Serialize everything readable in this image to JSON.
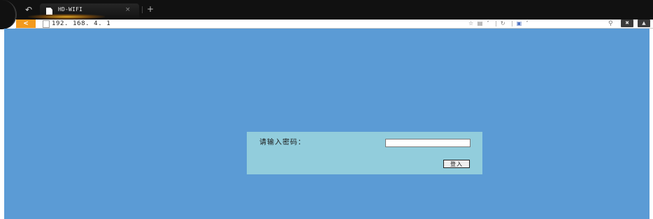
{
  "browser": {
    "tab": {
      "title": "HD-WIFI",
      "close_glyph": "×"
    },
    "new_tab_glyph": "+",
    "address_bar": {
      "url": "192. 168. 4. 1"
    },
    "icons": {
      "back": "back-arrow-icon",
      "page": "page-icon",
      "favorites": "star-icon",
      "reader": "reader-icon",
      "refresh": "refresh-icon",
      "extension": "extension-icon",
      "search": "search-icon"
    },
    "colors": {
      "back_button": "#f39a1e",
      "tab_strip": "#111111"
    }
  },
  "login": {
    "password_label": "请输入密码：",
    "password_value": "",
    "submit_label": "登入"
  },
  "colors": {
    "page_background": "#5b9bd5",
    "panel_background": "#92cddc"
  }
}
